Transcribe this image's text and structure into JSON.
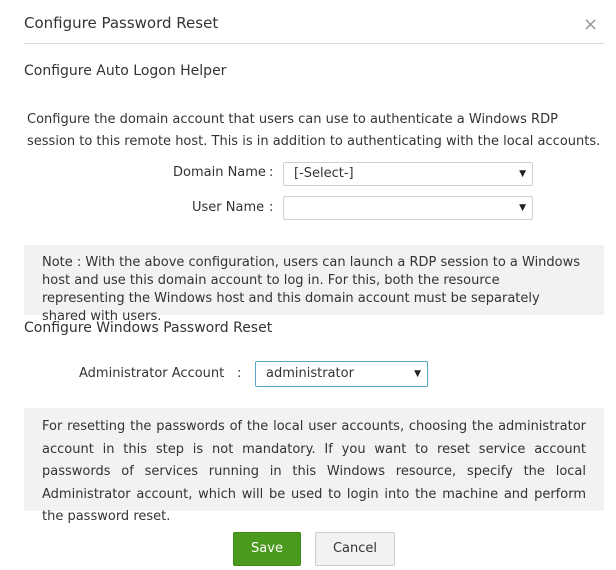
{
  "dialog": {
    "title": "Configure Password Reset",
    "close_glyph": "×"
  },
  "auto_logon": {
    "heading": "Configure Auto Logon Helper",
    "description": "Configure the domain account that users can use to authenticate a Windows RDP session to this remote host. This is in addition to authenticating with the local accounts.",
    "domain_label": "Domain Name",
    "domain_value": "[-Select-]",
    "user_label": "User Name",
    "user_value": "",
    "colon": ":",
    "note": "Note : With the above configuration, users can launch a RDP session to a Windows host and use this domain account to log in. For this, both the resource representing the Windows host and this domain account must be separately shared with users."
  },
  "password_reset": {
    "heading": "Configure Windows Password Reset",
    "admin_label": "Administrator Account",
    "admin_value": "administrator",
    "colon": ":",
    "info": "For resetting the passwords of the local user accounts, choosing the administrator account in this step is not mandatory. If you want to reset service account passwords of services running in this Windows resource, specify the local Administrator account, which will be used to login into the machine and perform the password reset."
  },
  "buttons": {
    "save": "Save",
    "cancel": "Cancel"
  },
  "icons": {
    "dropdown": "chevron-down-icon",
    "close": "close-icon"
  },
  "colors": {
    "save_button": "#4a9a1e",
    "note_background": "#f2f2f2",
    "focus_border": "#58a7c4"
  }
}
